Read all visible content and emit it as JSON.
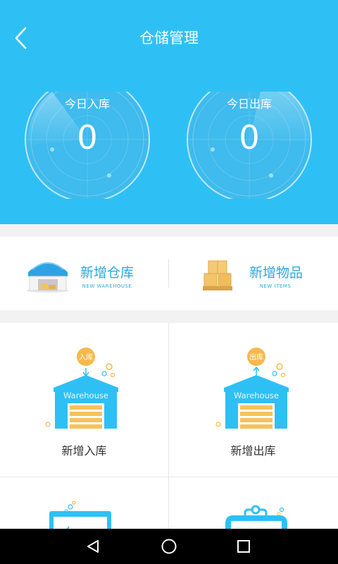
{
  "header": {
    "title": "仓储管理",
    "back_icon": "chevron-left-icon",
    "color": "#2ec0f5"
  },
  "gauges": [
    {
      "label": "今日入库",
      "value": "0"
    },
    {
      "label": "今日出库",
      "value": "0"
    }
  ],
  "quick_actions": [
    {
      "title": "新增仓库",
      "subtitle": "NEW WAREHOUSE",
      "icon": "warehouse-building-icon"
    },
    {
      "title": "新增物品",
      "subtitle": "NEW ITEMS",
      "icon": "boxes-pallet-icon"
    }
  ],
  "grid": [
    {
      "label": "新增入库",
      "badge": "入库",
      "sign": "Warehouse",
      "icon": "inbound-warehouse-icon"
    },
    {
      "label": "新增出库",
      "badge": "出库",
      "sign": "Warehouse",
      "icon": "outbound-warehouse-icon"
    }
  ],
  "accent_color": "#2ea9e2",
  "nav": [
    "back-triangle-icon",
    "home-circle-icon",
    "recents-square-icon"
  ]
}
